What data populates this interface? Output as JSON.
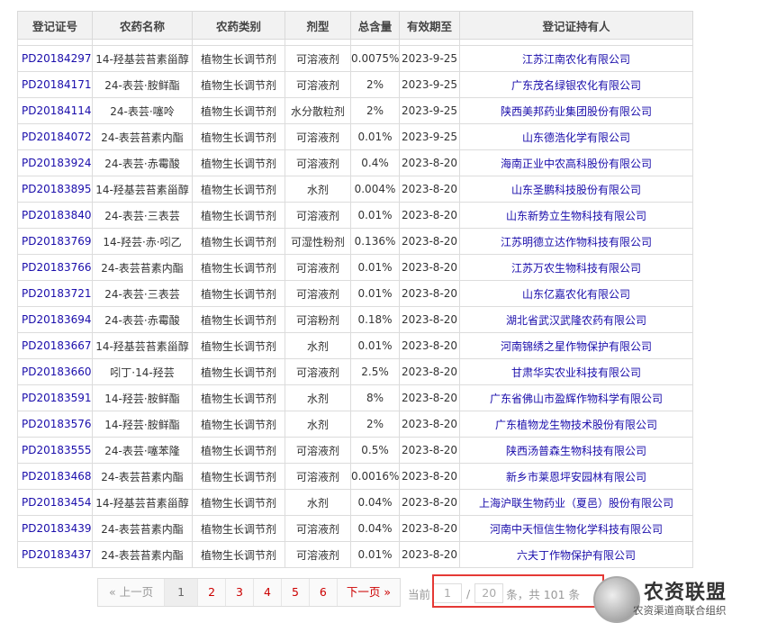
{
  "table": {
    "headers": [
      "登记证号",
      "农药名称",
      "农药类别",
      "剂型",
      "总含量",
      "有效期至",
      "登记证持有人"
    ],
    "rows": [
      [
        "PD20184297",
        "14-羟基芸苔素甾醇",
        "植物生长调节剂",
        "可溶液剂",
        "0.0075%",
        "2023-9-25",
        "江苏江南农化有限公司"
      ],
      [
        "PD20184171",
        "24-表芸·胺鲜酯",
        "植物生长调节剂",
        "可溶液剂",
        "2%",
        "2023-9-25",
        "广东茂名绿银农化有限公司"
      ],
      [
        "PD20184114",
        "24-表芸·噻呤",
        "植物生长调节剂",
        "水分散粒剂",
        "2%",
        "2023-9-25",
        "陕西美邦药业集团股份有限公司"
      ],
      [
        "PD20184072",
        "24-表芸苔素内酯",
        "植物生长调节剂",
        "可溶液剂",
        "0.01%",
        "2023-9-25",
        "山东德浩化学有限公司"
      ],
      [
        "PD20183924",
        "24-表芸·赤霉酸",
        "植物生长调节剂",
        "可溶液剂",
        "0.4%",
        "2023-8-20",
        "海南正业中农高科股份有限公司"
      ],
      [
        "PD20183895",
        "14-羟基芸苔素甾醇",
        "植物生长调节剂",
        "水剂",
        "0.004%",
        "2023-8-20",
        "山东圣鹏科技股份有限公司"
      ],
      [
        "PD20183840",
        "24-表芸·三表芸",
        "植物生长调节剂",
        "可溶液剂",
        "0.01%",
        "2023-8-20",
        "山东新势立生物科技有限公司"
      ],
      [
        "PD20183769",
        "14-羟芸·赤·吲乙",
        "植物生长调节剂",
        "可湿性粉剂",
        "0.136%",
        "2023-8-20",
        "江苏明德立达作物科技有限公司"
      ],
      [
        "PD20183766",
        "24-表芸苔素内酯",
        "植物生长调节剂",
        "可溶液剂",
        "0.01%",
        "2023-8-20",
        "江苏万农生物科技有限公司"
      ],
      [
        "PD20183721",
        "24-表芸·三表芸",
        "植物生长调节剂",
        "可溶液剂",
        "0.01%",
        "2023-8-20",
        "山东亿嘉农化有限公司"
      ],
      [
        "PD20183694",
        "24-表芸·赤霉酸",
        "植物生长调节剂",
        "可溶粉剂",
        "0.18%",
        "2023-8-20",
        "湖北省武汉武隆农药有限公司"
      ],
      [
        "PD20183667",
        "14-羟基芸苔素甾醇",
        "植物生长调节剂",
        "水剂",
        "0.01%",
        "2023-8-20",
        "河南锦绣之星作物保护有限公司"
      ],
      [
        "PD20183660",
        "吲丁·14-羟芸",
        "植物生长调节剂",
        "可溶液剂",
        "2.5%",
        "2023-8-20",
        "甘肃华实农业科技有限公司"
      ],
      [
        "PD20183591",
        "14-羟芸·胺鲜酯",
        "植物生长调节剂",
        "水剂",
        "8%",
        "2023-8-20",
        "广东省佛山市盈辉作物科学有限公司"
      ],
      [
        "PD20183576",
        "14-羟芸·胺鲜酯",
        "植物生长调节剂",
        "水剂",
        "2%",
        "2023-8-20",
        "广东植物龙生物技术股份有限公司"
      ],
      [
        "PD20183555",
        "24-表芸·噻苯隆",
        "植物生长调节剂",
        "可溶液剂",
        "0.5%",
        "2023-8-20",
        "陕西汤普森生物科技有限公司"
      ],
      [
        "PD20183468",
        "24-表芸苔素内酯",
        "植物生长调节剂",
        "可溶液剂",
        "0.0016%",
        "2023-8-20",
        "新乡市莱恩坪安园林有限公司"
      ],
      [
        "PD20183454",
        "14-羟基芸苔素甾醇",
        "植物生长调节剂",
        "水剂",
        "0.04%",
        "2023-8-20",
        "上海沪联生物药业（夏邑）股份有限公司"
      ],
      [
        "PD20183439",
        "24-表芸苔素内酯",
        "植物生长调节剂",
        "可溶液剂",
        "0.04%",
        "2023-8-20",
        "河南中天恒信生物化学科技有限公司"
      ],
      [
        "PD20183437",
        "24-表芸苔素内酯",
        "植物生长调节剂",
        "可溶液剂",
        "0.01%",
        "2023-8-20",
        "六夫丁作物保护有限公司"
      ]
    ]
  },
  "pagination": {
    "prev_label": "« 上一页",
    "current": "1",
    "pages": [
      "2",
      "3",
      "4",
      "5",
      "6"
    ],
    "next_label": "下一页 »",
    "current_label": "当前",
    "page_input": "1",
    "total_pages": "20",
    "total_text": "条，共 101 条"
  },
  "logo": {
    "title": "农资联盟",
    "subtitle": "农资渠道商联合组织"
  },
  "colors": {
    "link": "#1a0dab",
    "page_link": "#cc0000",
    "highlight_box": "#e53935"
  }
}
